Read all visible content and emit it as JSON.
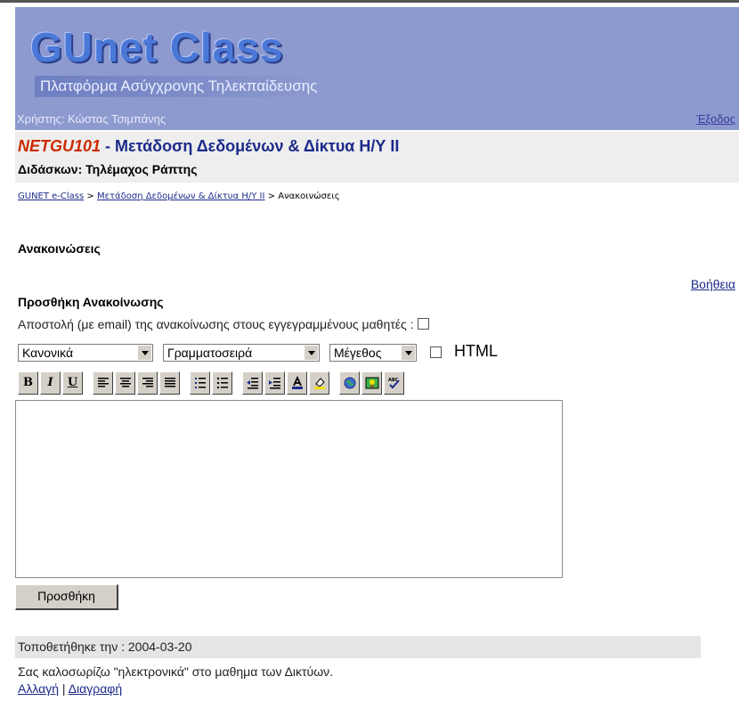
{
  "header": {
    "logo_main": "GUnet Class",
    "logo_subtitle": "Πλατφόρμα Ασύγχρονης Τηλεκπαίδευσης",
    "user_label": "Χρήστης: Κώστας Τσιμπάνης",
    "logout_label": "Έξοδος"
  },
  "course": {
    "code": "NETGU101",
    "separator": " - ",
    "title": "Μετάδοση Δεδομένων & Δίκτυα Η/Υ ΙΙ",
    "teacher": "Διδάσκων: Τηλέμαχος Ράπτης"
  },
  "breadcrumb": {
    "home": "GUNET e-Class",
    "sep1": " > ",
    "course": "Μετάδοση Δεδομένων & Δίκτυα Η/Υ ΙΙ",
    "sep2": " > ",
    "current": "Ανακοινώσεις"
  },
  "page": {
    "heading": "Ανακοινώσεις",
    "help_link": "Βοήθεια",
    "add_heading": "Προσθήκη Ανακοίνωσης",
    "email_option": "Αποστολή (με email) της ανακοίνωσης στους εγγεγραμμένους μαθητές :"
  },
  "editor": {
    "style_select": "Κανονικά",
    "font_select": "Γραμματοσειρά",
    "size_select": "Μέγεθος",
    "html_toggle": "HTML",
    "toolbar_icons": [
      "bold-icon",
      "italic-icon",
      "underline-icon",
      "align-left-icon",
      "align-center-icon",
      "align-right-icon",
      "justify-icon",
      "ordered-list-icon",
      "bullet-list-icon",
      "outdent-icon",
      "indent-icon",
      "text-color-icon",
      "background-color-icon",
      "link-icon",
      "image-icon",
      "spell-check-icon"
    ],
    "bold_label": "B",
    "italic_label": "I",
    "underline_label": "U",
    "content": ""
  },
  "submit_label": "Προσθήκη",
  "announcements": [
    {
      "posted": "Τοποθετήθηκε την : 2004-03-20",
      "text": "Σας καλοσωρίζω \"ηλεκτρονικά\" στο μαθημα των Δικτύων.",
      "edit_label": "Αλλαγή",
      "separator": " | ",
      "delete_label": "Διαγραφή"
    }
  ],
  "colors": {
    "banner": "#8d9acf",
    "course_code": "#cc2a00",
    "course_title": "#1c2a8a",
    "link": "#1c2a8a"
  }
}
